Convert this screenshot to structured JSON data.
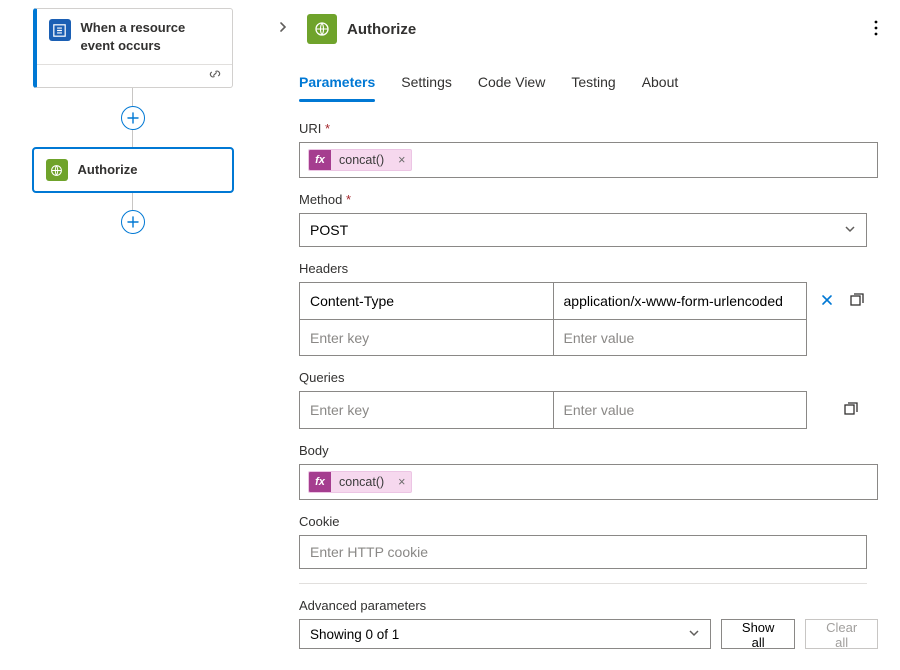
{
  "flow": {
    "trigger": {
      "title": "When a resource event occurs"
    },
    "action": {
      "title": "Authorize"
    }
  },
  "panel": {
    "title": "Authorize",
    "tabs": [
      "Parameters",
      "Settings",
      "Code View",
      "Testing",
      "About"
    ],
    "activeTab": 0,
    "sections": {
      "uri": {
        "label": "URI",
        "token": "concat()"
      },
      "method": {
        "label": "Method",
        "value": "POST"
      },
      "headers": {
        "label": "Headers",
        "rows": [
          {
            "key": "Content-Type",
            "value": "application/x-www-form-urlencoded"
          }
        ],
        "placeholderKey": "Enter key",
        "placeholderValue": "Enter value"
      },
      "queries": {
        "label": "Queries",
        "placeholderKey": "Enter key",
        "placeholderValue": "Enter value"
      },
      "body": {
        "label": "Body",
        "token": "concat()"
      },
      "cookie": {
        "label": "Cookie",
        "placeholder": "Enter HTTP cookie"
      }
    },
    "advanced": {
      "label": "Advanced parameters",
      "summary": "Showing 0 of 1",
      "showAll": "Show all",
      "clearAll": "Clear all"
    }
  }
}
